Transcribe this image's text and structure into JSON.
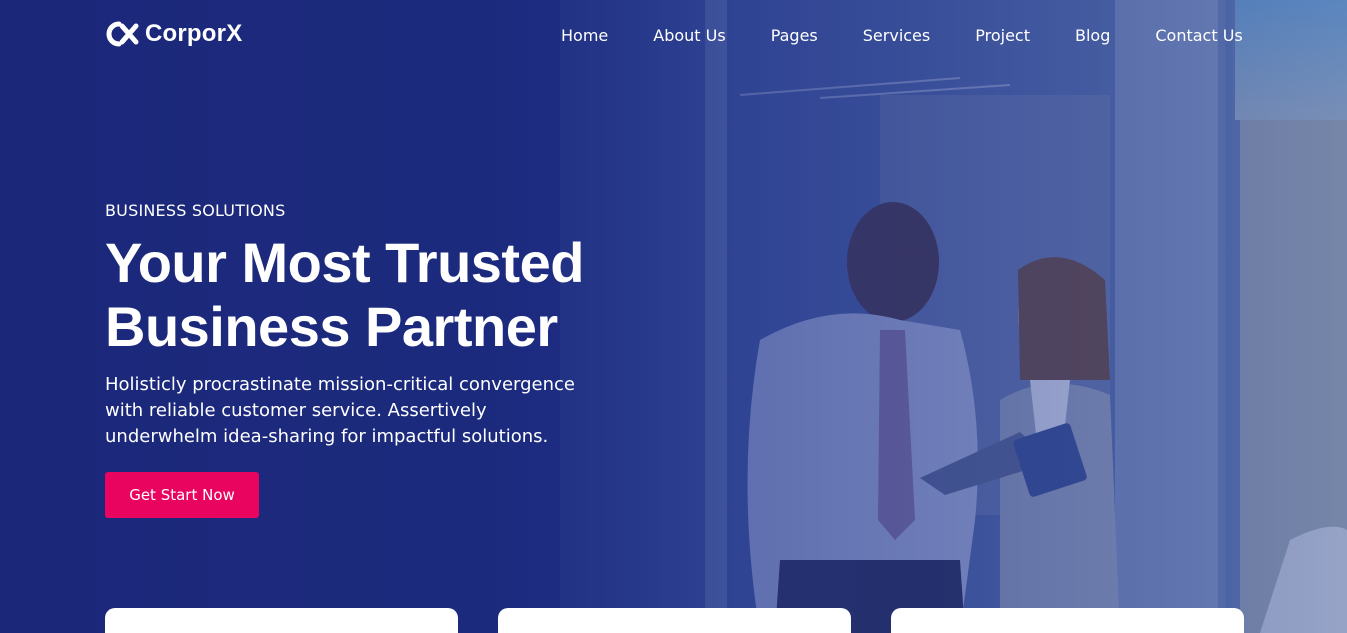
{
  "brand": {
    "name": "CorporX",
    "logo_icon": "cx-logo-icon"
  },
  "nav": {
    "items": [
      "Home",
      "About Us",
      "Pages",
      "Services",
      "Project",
      "Blog",
      "Contact Us"
    ]
  },
  "hero": {
    "eyebrow": "BUSINESS SOLUTIONS",
    "headline_line1": "Your Most Trusted",
    "headline_line2": "Business Partner",
    "description": "Holisticly procrastinate mission-critical convergence with reliable customer service. Assertively underwhelm idea-sharing for impactful solutions.",
    "cta_label": "Get Start Now"
  },
  "colors": {
    "primary_dark": "#1c2a7e",
    "accent": "#e8045f",
    "text": "#ffffff"
  },
  "cards_count_visible": 3
}
